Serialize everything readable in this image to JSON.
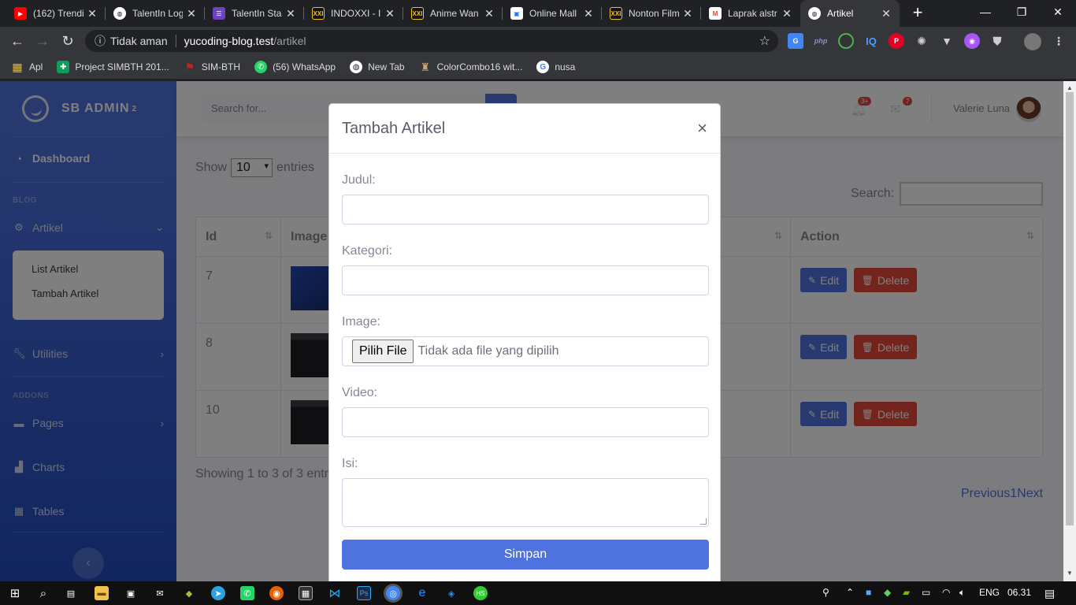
{
  "browser": {
    "tabs": [
      {
        "title": "(162) Trendi",
        "icon": "youtube-icon",
        "color": "#ff0000"
      },
      {
        "title": "TalentIn Log",
        "icon": "globe-icon",
        "color": "#ffffff"
      },
      {
        "title": "TalentIn Sta",
        "icon": "list-icon",
        "color": "#6f42c1"
      },
      {
        "title": "INDOXXI - I",
        "icon": "xxi-icon",
        "color": "#f5c518"
      },
      {
        "title": "Anime Wan",
        "icon": "xxi-icon",
        "color": "#f5c518"
      },
      {
        "title": "Online Mall",
        "icon": "bag-icon",
        "color": "#1a73e8"
      },
      {
        "title": "Nonton Film",
        "icon": "xxi-icon",
        "color": "#f5c518"
      },
      {
        "title": "Laprak alstr",
        "icon": "gmail-icon",
        "color": "#ea4335"
      },
      {
        "title": "Artikel",
        "icon": "globe-icon",
        "color": "#ffffff"
      }
    ],
    "address": {
      "security": "Tidak aman",
      "host": "yucoding-blog.test",
      "path": "/artikel"
    },
    "bookmarks": [
      {
        "label": "Apl",
        "icon": "apps-grid-icon"
      },
      {
        "label": "Project SIMBTH 201...",
        "icon": "sheets-icon"
      },
      {
        "label": "SIM-BTH",
        "icon": "flag-icon"
      },
      {
        "label": "(56) WhatsApp",
        "icon": "whatsapp-icon"
      },
      {
        "label": "New Tab",
        "icon": "globe-icon"
      },
      {
        "label": "ColorCombo16 wit...",
        "icon": "bottle-icon"
      },
      {
        "label": "nusa",
        "icon": "google-icon"
      }
    ]
  },
  "sidebar": {
    "brand": "SB ADMIN",
    "brand_sup": "2",
    "dashboard": "Dashboard",
    "heading_blog": "BLOG",
    "artikel": "Artikel",
    "sub_items": [
      "List Artikel",
      "Tambah Artikel"
    ],
    "utilities": "Utilities",
    "heading_addons": "ADDONS",
    "pages": "Pages",
    "charts": "Charts",
    "tables": "Tables"
  },
  "topbar": {
    "search_placeholder": "Search for...",
    "alerts_badge": "3+",
    "messages_badge": "7",
    "user_name": "Valerie Luna"
  },
  "datatable": {
    "show": "Show",
    "entries_value": "10",
    "entries": "entries",
    "search_label": "Search:",
    "columns": [
      "Id",
      "Image",
      "Action"
    ],
    "rows": [
      {
        "id": "7"
      },
      {
        "id": "8"
      },
      {
        "id": "10"
      }
    ],
    "edit_label": "Edit",
    "delete_label": "Delete",
    "showing": "Showing 1 to 3 of 3 entries",
    "previous": "Previous",
    "page": "1",
    "next": "Next"
  },
  "modal": {
    "title": "Tambah Artikel",
    "close": "×",
    "judul_label": "Judul:",
    "kategori_label": "Kategori:",
    "image_label": "Image:",
    "file_button": "Pilih File",
    "file_status": "Tidak ada file yang dipilih",
    "video_label": "Video:",
    "isi_label": "Isi:",
    "submit": "Simpan"
  },
  "taskbar": {
    "lang": "ENG",
    "time": "06.31"
  }
}
